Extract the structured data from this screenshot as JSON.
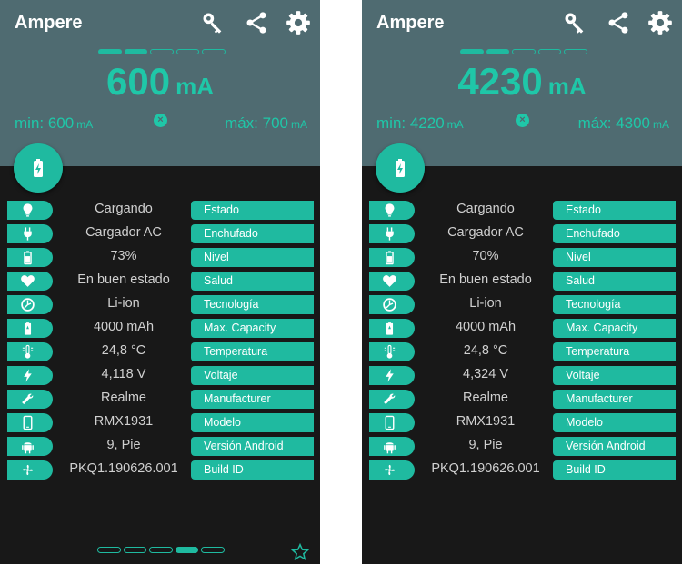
{
  "app": {
    "title": "Ampere"
  },
  "colors": {
    "accent": "#1fbaa0",
    "header": "#4f6b71",
    "background": "#181818"
  },
  "phones": [
    {
      "current_value": "600",
      "current_unit": "mA",
      "min_label": "min: 600",
      "max_label": "máx: 700",
      "minmax_unit": "mA",
      "pager_bottom_active_index": 3,
      "rows": [
        {
          "icon": "bulb-icon",
          "value": "Cargando",
          "label": "Estado"
        },
        {
          "icon": "plug-icon",
          "value": "Cargador AC",
          "label": "Enchufado"
        },
        {
          "icon": "battery-level-icon",
          "value": "73%",
          "label": "Nivel"
        },
        {
          "icon": "heart-icon",
          "value": "En buen estado",
          "label": "Salud"
        },
        {
          "icon": "chip-icon",
          "value": "Li-ion",
          "label": "Tecnología"
        },
        {
          "icon": "battery-capacity-icon",
          "value": "4000 mAh",
          "label": "Max. Capacity"
        },
        {
          "icon": "thermometer-icon",
          "value": "24,8 °C",
          "label": "Temperatura"
        },
        {
          "icon": "bolt-icon",
          "value": "4,118 V",
          "label": "Voltaje"
        },
        {
          "icon": "wrench-icon",
          "value": "Realme",
          "label": "Manufacturer"
        },
        {
          "icon": "phone-icon",
          "value": "RMX1931",
          "label": "Modelo"
        },
        {
          "icon": "android-icon",
          "value": "9, Pie",
          "label": "Versión Android"
        },
        {
          "icon": "fan-icon",
          "value": "PKQ1.190626.001",
          "label": "Build ID"
        }
      ]
    },
    {
      "current_value": "4230",
      "current_unit": "mA",
      "min_label": "min: 4220",
      "max_label": "máx: 4300",
      "minmax_unit": "mA",
      "rows": [
        {
          "icon": "bulb-icon",
          "value": "Cargando",
          "label": "Estado"
        },
        {
          "icon": "plug-icon",
          "value": "Cargador AC",
          "label": "Enchufado"
        },
        {
          "icon": "battery-level-icon",
          "value": "70%",
          "label": "Nivel"
        },
        {
          "icon": "heart-icon",
          "value": "En buen estado",
          "label": "Salud"
        },
        {
          "icon": "chip-icon",
          "value": "Li-ion",
          "label": "Tecnología"
        },
        {
          "icon": "battery-capacity-icon",
          "value": "4000 mAh",
          "label": "Max. Capacity"
        },
        {
          "icon": "thermometer-icon",
          "value": "24,8 °C",
          "label": "Temperatura"
        },
        {
          "icon": "bolt-icon",
          "value": "4,324 V",
          "label": "Voltaje"
        },
        {
          "icon": "wrench-icon",
          "value": "Realme",
          "label": "Manufacturer"
        },
        {
          "icon": "phone-icon",
          "value": "RMX1931",
          "label": "Modelo"
        },
        {
          "icon": "android-icon",
          "value": "9, Pie",
          "label": "Versión Android"
        },
        {
          "icon": "fan-icon",
          "value": "PKQ1.190626.001",
          "label": "Build ID"
        }
      ]
    }
  ]
}
